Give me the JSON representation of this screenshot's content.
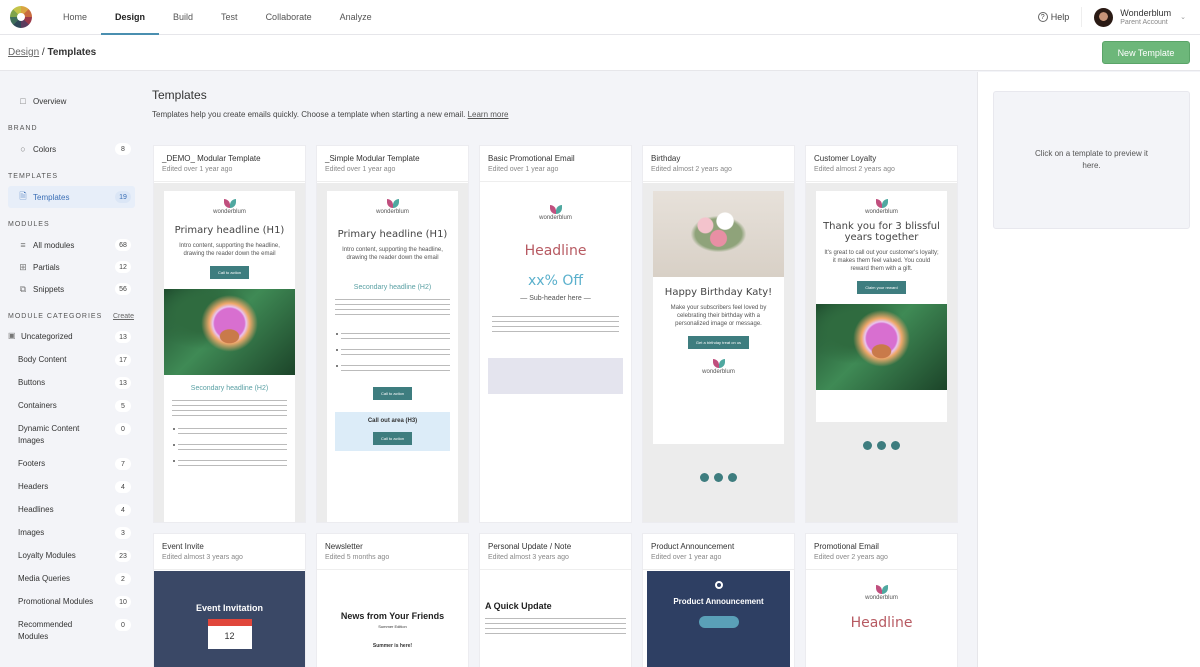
{
  "topnav": {
    "items": [
      {
        "label": "Home"
      },
      {
        "label": "Design",
        "active": true
      },
      {
        "label": "Build"
      },
      {
        "label": "Test"
      },
      {
        "label": "Collaborate"
      },
      {
        "label": "Analyze"
      }
    ],
    "help_label": "Help",
    "account_name": "Wonderblum",
    "account_sub": "Parent Account"
  },
  "breadcrumb": {
    "parent": "Design",
    "separator": " / ",
    "current": "Templates"
  },
  "toolbar": {
    "new_template_label": "New Template"
  },
  "colors": {
    "accent": "#4a8fb0",
    "primary_button": "#6db77a",
    "active_sidebar": "#3b6fb6"
  },
  "sidebar": {
    "overview": "Overview",
    "brand_heading": "BRAND",
    "brand": [
      {
        "label": "Colors",
        "count": "8"
      }
    ],
    "templates_heading": "TEMPLATES",
    "templates": [
      {
        "label": "Templates",
        "count": "19",
        "active": true
      }
    ],
    "modules_heading": "MODULES",
    "modules": [
      {
        "label": "All modules",
        "count": "68"
      },
      {
        "label": "Partials",
        "count": "12"
      },
      {
        "label": "Snippets",
        "count": "56"
      }
    ],
    "categories_heading": "MODULE CATEGORIES",
    "create_label": "Create",
    "categories": [
      {
        "label": "Uncategorized",
        "count": "13"
      },
      {
        "label": "Body Content",
        "count": "17"
      },
      {
        "label": "Buttons",
        "count": "13"
      },
      {
        "label": "Containers",
        "count": "5"
      },
      {
        "label": "Dynamic Content Images",
        "count": "0"
      },
      {
        "label": "Footers",
        "count": "7"
      },
      {
        "label": "Headers",
        "count": "4"
      },
      {
        "label": "Headlines",
        "count": "4"
      },
      {
        "label": "Images",
        "count": "3"
      },
      {
        "label": "Loyalty Modules",
        "count": "23"
      },
      {
        "label": "Media Queries",
        "count": "2"
      },
      {
        "label": "Promotional Modules",
        "count": "10"
      },
      {
        "label": "Recommended Modules",
        "count": "0"
      }
    ]
  },
  "main": {
    "title": "Templates",
    "description": "Templates help you create emails quickly. Choose a template when starting a new email.",
    "learn_more": "Learn more",
    "templates": [
      {
        "title": "_DEMO_ Modular Template",
        "edited": "Edited over 1 year ago"
      },
      {
        "title": "_Simple Modular Template",
        "edited": "Edited over 1 year ago"
      },
      {
        "title": "Basic Promotional Email",
        "edited": "Edited over 1 year ago"
      },
      {
        "title": "Birthday",
        "edited": "Edited almost 2 years ago"
      },
      {
        "title": "Customer Loyalty",
        "edited": "Edited almost 2 years ago"
      },
      {
        "title": "Event Invite",
        "edited": "Edited almost 3 years ago"
      },
      {
        "title": "Newsletter",
        "edited": "Edited 5 months ago"
      },
      {
        "title": "Personal Update / Note",
        "edited": "Edited almost 3 years ago"
      },
      {
        "title": "Product Announcement",
        "edited": "Edited over 1 year ago"
      },
      {
        "title": "Promotional Email",
        "edited": "Edited over 2 years ago"
      }
    ],
    "thumb_text": {
      "brand": "wonderblum",
      "primary_h1": "Primary headline (H1)",
      "intro": "Intro content, supporting the headline, drawing the reader down the email",
      "cta": "Call to action",
      "secondary_h2": "Secondary headline (H2)",
      "callout": "Call out area (H3)",
      "headline": "Headline",
      "discount": "xx% Off",
      "subheader": "— Sub-header here —",
      "birthday_h": "Happy Birthday Katy!",
      "birthday_body": "Make your subscribers feel loved by celebrating their birthday with a personalized image or message.",
      "birthday_cta": "Get a birthday treat on us",
      "loyalty_h": "Thank you for 3 blissful years together",
      "loyalty_body": "It's great to call out your customer's loyalty; it makes them feel valued. You could reward them with a gift.",
      "loyalty_cta": "Claim your reward",
      "event_h": "Event Invitation",
      "event_day": "12",
      "news_h": "News from Your Friends",
      "news_sub": "Summer Edition",
      "news_body": "Summer is here!",
      "update_h": "A Quick Update",
      "product_h": "Product Announcement"
    }
  },
  "preview": {
    "placeholder": "Click on a template to preview it here."
  }
}
